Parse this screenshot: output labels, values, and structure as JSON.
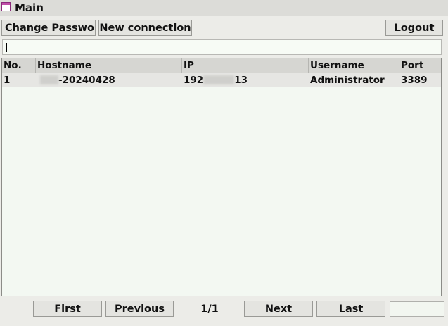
{
  "window": {
    "title": "Main",
    "icon": "window-icon"
  },
  "toolbar": {
    "change_password_label": "Change Password",
    "new_connection_label": "New connection",
    "logout_label": "Logout"
  },
  "search": {
    "value": "",
    "placeholder": ""
  },
  "table": {
    "columns": [
      "No.",
      "Hostname",
      "IP",
      "Username",
      "Port"
    ],
    "rows": [
      {
        "no": "1",
        "hostname_suffix": "-20240428",
        "ip_prefix": "192",
        "ip_suffix": "13",
        "username": "Administrator",
        "port": "3389"
      }
    ]
  },
  "pagination": {
    "first_label": "First",
    "previous_label": "Previous",
    "page_indicator": "1/1",
    "next_label": "Next",
    "last_label": "Last"
  }
}
